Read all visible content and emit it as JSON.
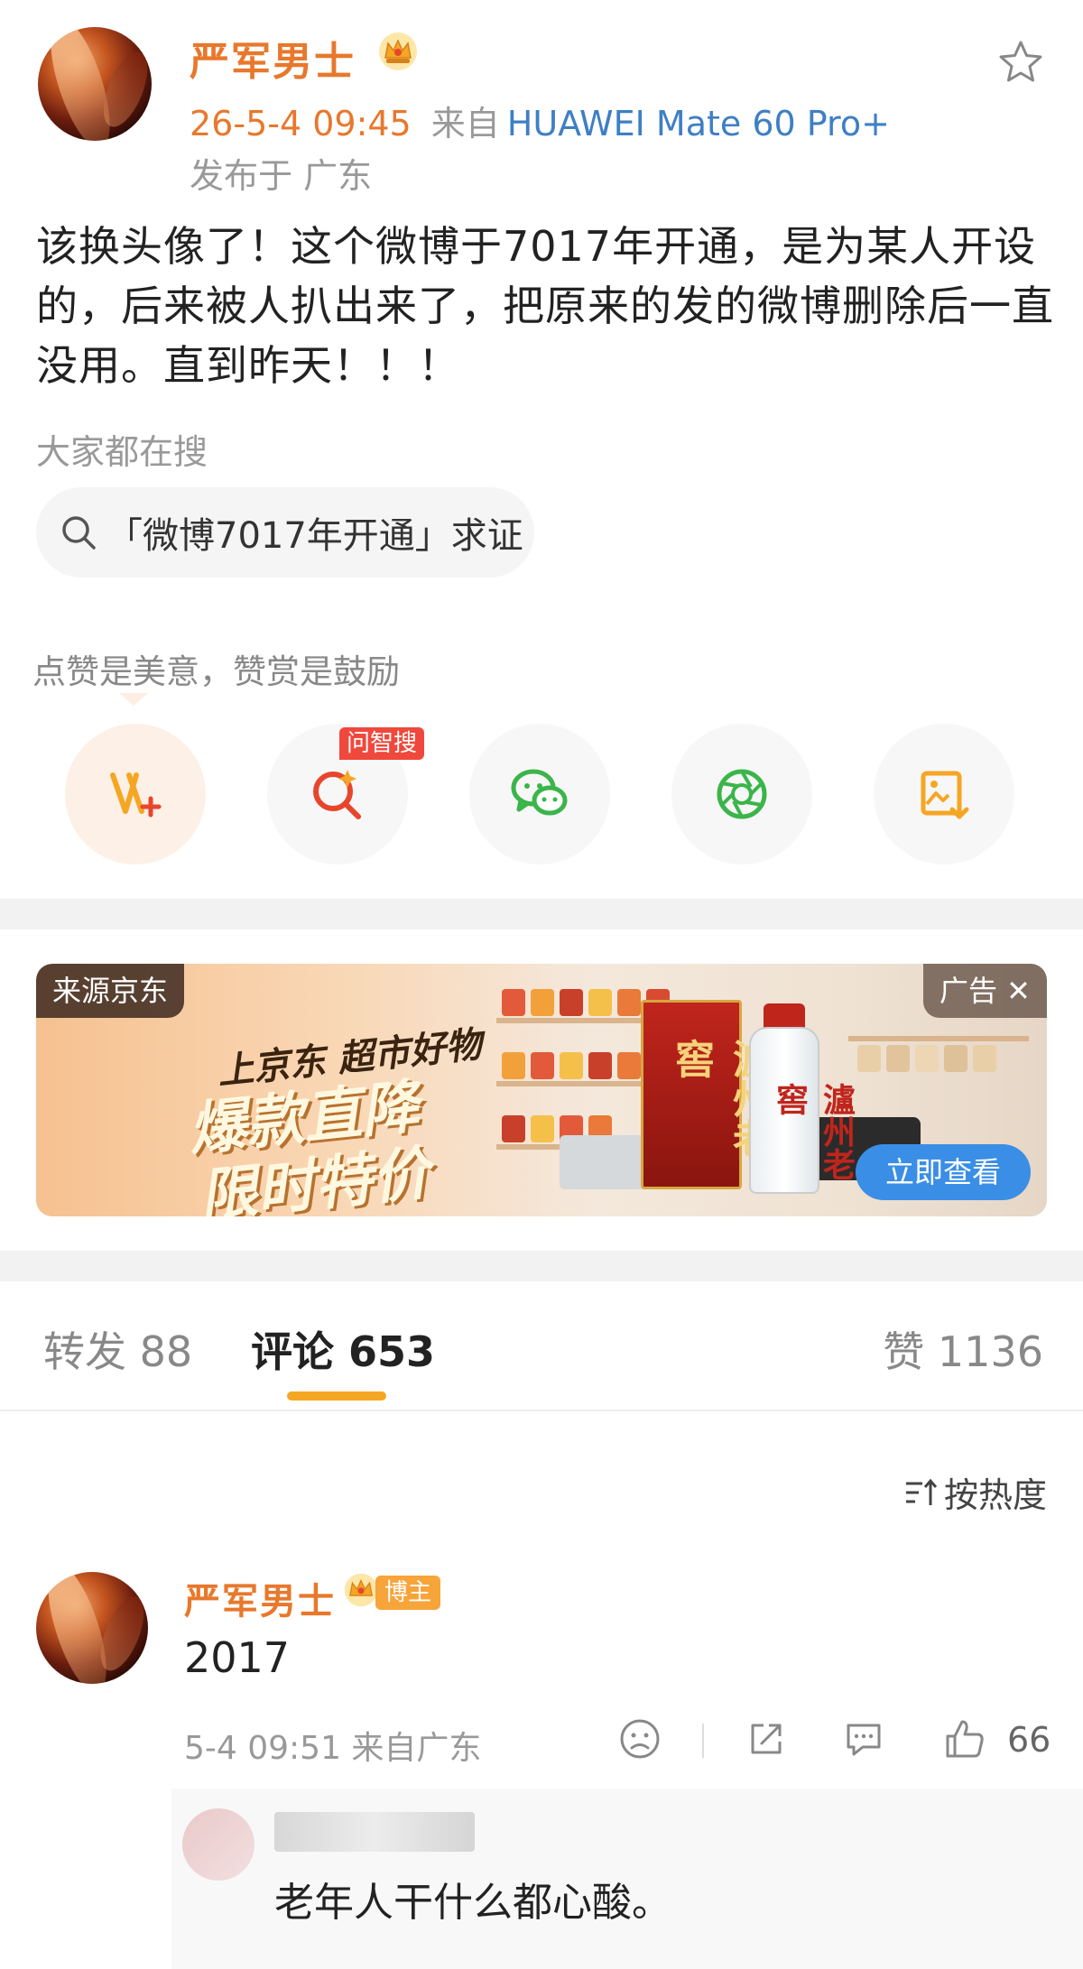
{
  "post": {
    "author": "严军男士",
    "time": "26-5-4 09:45",
    "from_prefix": "来自",
    "device": "HUAWEI Mate 60 Pro+",
    "location": "发布于 广东",
    "body": "该换头像了！这个微博于7017年开通，是为某人开设的，后来被人扒出来了，把原来的发的微博删除后一直没用。直到昨天！！！",
    "search_title": "大家都在搜",
    "search_chip": "「微博7017年开通」求证"
  },
  "reward": {
    "tip": "点赞是美意，赞赏是鼓励",
    "wenzhi_badge": "问智搜"
  },
  "ad": {
    "source": "来源京东",
    "label": "广告 ✕",
    "slogan_top": "上京东 超市好物",
    "slogan_line1": "爆款直降",
    "slogan_line2": "限时特价",
    "box_text": "瀘州老窖",
    "bottle_text": "瀘州老窖",
    "cta": "立即查看"
  },
  "tabs": {
    "repost": "转发 88",
    "comments": "评论 653",
    "likes": "赞 1136"
  },
  "sort": {
    "label": "按热度"
  },
  "comment": {
    "author": "严军男士",
    "badge": "博主",
    "text": "2017",
    "meta": "5-4 09:51 来自广东",
    "like_count": "66"
  },
  "reply": {
    "text": "老年人干什么都心酸。"
  },
  "colors": {
    "brand_orange": "#e8782c",
    "link_blue": "#3e7fc4",
    "tab_indicator": "#f5a623",
    "cta_blue": "#3a8ee6",
    "wechat_green": "#3bb54a",
    "badge_red": "#f0483c"
  },
  "icons": {
    "crown": "crown-icon",
    "star": "star-icon",
    "search": "search-icon",
    "reward": "v-plus-icon",
    "wenzhi": "sparkle-search-icon",
    "wechat": "wechat-icon",
    "moments": "moments-aperture-icon",
    "save_image": "save-image-icon",
    "sort": "sort-icon",
    "frown": "frown-icon",
    "share": "share-icon",
    "comment": "comment-icon",
    "like": "thumbs-up-icon"
  }
}
